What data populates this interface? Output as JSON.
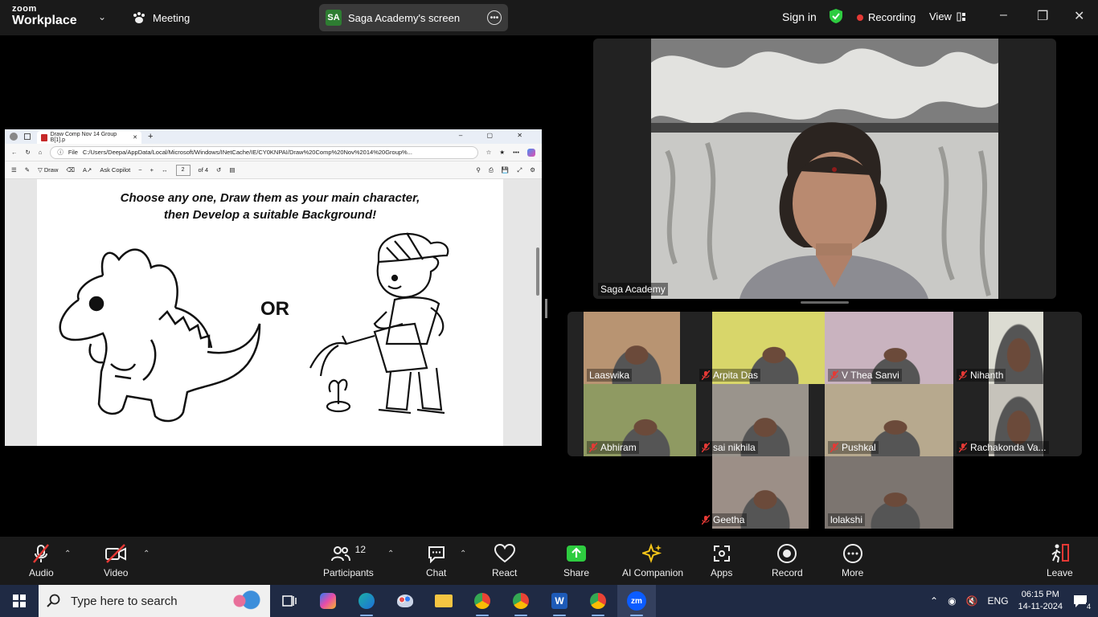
{
  "topbar": {
    "logo_line1": "zoom",
    "logo_line2": "Workplace",
    "meeting_label": "Meeting",
    "share_badge": "SA",
    "share_label": "Saga Academy's screen",
    "signin_label": "Sign in",
    "recording_label": "Recording",
    "view_label": "View"
  },
  "browser": {
    "tab_title": "Draw Comp Nov 14 Group B[1].p",
    "address_prefix": "File",
    "address": "C:/Users/Deepa/AppData/Local/Microsoft/Windows/INetCache/IE/CY0KNPAI/Draw%20Comp%20Nov%2014%20Group%...",
    "draw_label": "Draw",
    "copilot_label": "Ask Copilot",
    "page_current": "2",
    "page_total": "of 4"
  },
  "pdf": {
    "line1": "Choose any one, Draw them as your main character,",
    "line2": "then Develop a suitable Background!",
    "or_text": "OR"
  },
  "speaker": {
    "name": "Saga Academy"
  },
  "gallery": [
    {
      "name": "Laaswika",
      "muted": false,
      "bg": "#b89472"
    },
    {
      "name": "Arpita Das",
      "muted": true,
      "bg": "#d8d66a"
    },
    {
      "name": "V Thea Sanvi",
      "muted": true,
      "bg": "#c9b3bf"
    },
    {
      "name": "Nihanth",
      "muted": true,
      "bg": "#dcdcd2"
    },
    {
      "name": "Abhiram",
      "muted": true,
      "bg": "#8f9a62"
    },
    {
      "name": "sai nikhila",
      "muted": true,
      "bg": "#9a948c"
    },
    {
      "name": "Pushkal",
      "muted": true,
      "bg": "#b7a98e"
    },
    {
      "name": "Rachakonda Va...",
      "muted": true,
      "bg": "#c6c3bb"
    },
    {
      "name": "Geetha",
      "muted": true,
      "bg": "#9c8f87"
    },
    {
      "name": "lolakshi",
      "muted": false,
      "bg": "#7c7570"
    }
  ],
  "toolbar": {
    "audio": "Audio",
    "video": "Video",
    "participants": "Participants",
    "participants_count": "12",
    "chat": "Chat",
    "react": "React",
    "share": "Share",
    "ai": "AI Companion",
    "apps": "Apps",
    "record": "Record",
    "more": "More",
    "leave": "Leave"
  },
  "taskbar": {
    "search_placeholder": "Type here to search",
    "lang": "ENG",
    "time": "06:15 PM",
    "date": "14-11-2024",
    "notif_count": "4"
  },
  "colors": {
    "share_green": "#2ecc40",
    "rec_red": "#e53935",
    "accent_blue": "#0b5cff"
  }
}
